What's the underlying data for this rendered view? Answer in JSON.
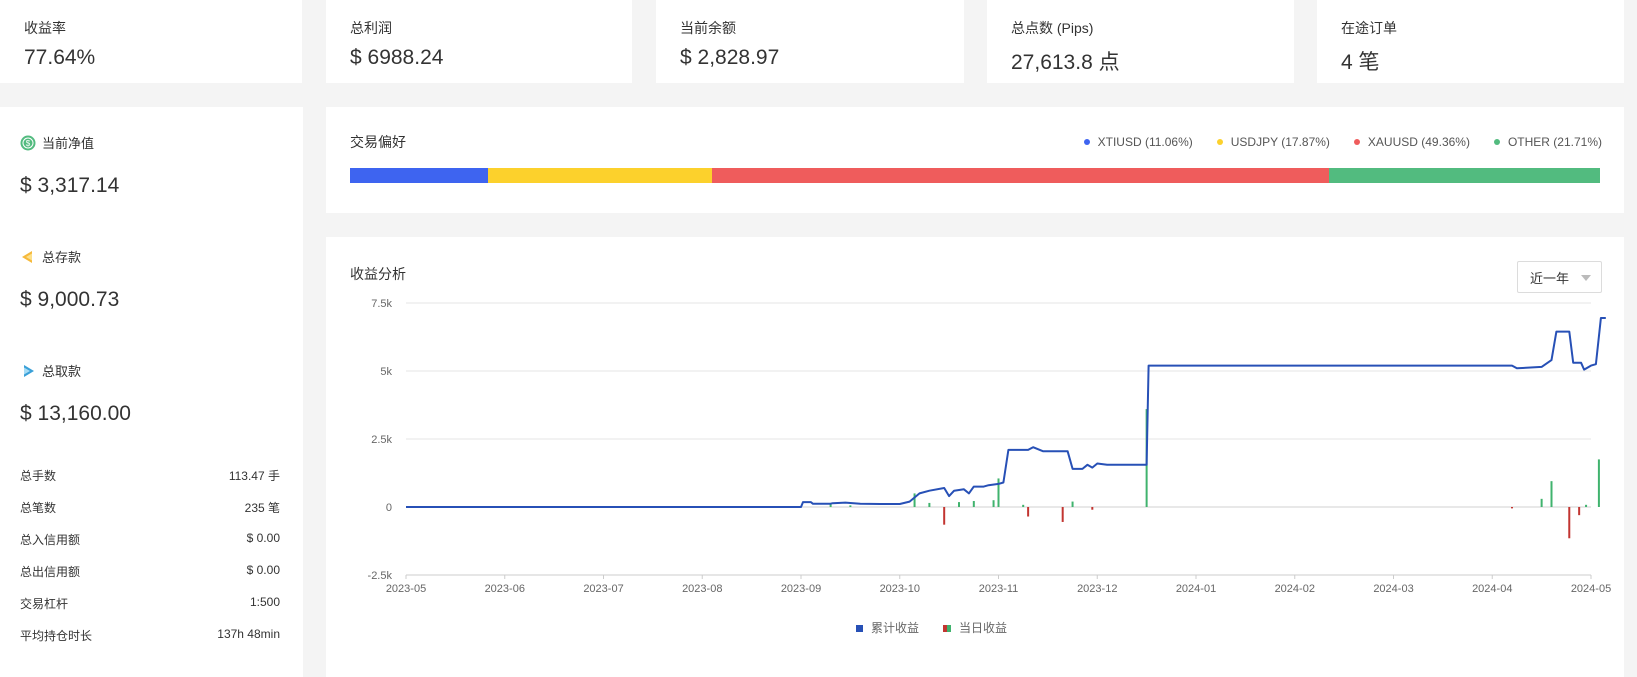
{
  "stats": [
    {
      "label": "收益率",
      "value": "77.64%"
    },
    {
      "label": "总利润",
      "value": "$ 6988.24"
    },
    {
      "label": "当前余额",
      "value": "$ 2,828.97"
    },
    {
      "label": "总点数 (Pips)",
      "value": "27,613.8 点"
    },
    {
      "label": "在途订单",
      "value": "4 笔"
    }
  ],
  "side": {
    "equity": {
      "label": "当前净值",
      "value": "$ 3,317.14",
      "icon": "dollar-circle-icon"
    },
    "deposit": {
      "label": "总存款",
      "value": "$ 9,000.73",
      "icon": "deposit-icon"
    },
    "withdraw": {
      "label": "总取款",
      "value": "$ 13,160.00",
      "icon": "withdraw-icon"
    },
    "details": [
      {
        "label": "总手数",
        "value": "113.47 手"
      },
      {
        "label": "总笔数",
        "value": "235 笔"
      },
      {
        "label": "总入信用额",
        "value": "$ 0.00"
      },
      {
        "label": "总出信用额",
        "value": "$ 0.00"
      },
      {
        "label": "交易杠杆",
        "value": "1:500"
      },
      {
        "label": "平均持仓时长",
        "value": "137h 48min"
      }
    ]
  },
  "preference": {
    "title": "交易偏好",
    "items": [
      {
        "label": "XTIUSD (11.06%)",
        "pct": 11.06,
        "color": "#3e64f0"
      },
      {
        "label": "USDJPY (17.87%)",
        "pct": 17.87,
        "color": "#fcd12c"
      },
      {
        "label": "XAUUSD (49.36%)",
        "pct": 49.36,
        "color": "#ef5c5c"
      },
      {
        "label": "OTHER (21.71%)",
        "pct": 21.71,
        "color": "#52bb7f"
      }
    ]
  },
  "analysis": {
    "title": "收益分析",
    "range_select": "近一年"
  },
  "chart_data": {
    "type": "line",
    "categories": [
      "2023-05",
      "2023-06",
      "2023-07",
      "2023-08",
      "2023-09",
      "2023-10",
      "2023-11",
      "2023-12",
      "2024-01",
      "2024-02",
      "2024-03",
      "2024-04",
      "2024-05"
    ],
    "ylim": [
      -2500,
      7500
    ],
    "yticks": [
      -2500,
      0,
      2500,
      5000,
      7500
    ],
    "ytick_labels": [
      "-2.5k",
      "0",
      "2.5k",
      "5k",
      "7.5k"
    ],
    "legend": {
      "cumulative": "累计收益",
      "daily": "当日收益"
    },
    "colors": {
      "cumulative": "#2750b6",
      "gain": "#40b36e",
      "loss": "#c23531"
    },
    "series": [
      {
        "name": "累计收益",
        "points": [
          [
            0,
            0
          ],
          [
            4.0,
            0
          ],
          [
            4.02,
            180
          ],
          [
            4.1,
            180
          ],
          [
            4.12,
            120
          ],
          [
            4.3,
            120
          ],
          [
            4.32,
            140
          ],
          [
            4.45,
            160
          ],
          [
            4.6,
            120
          ],
          [
            4.8,
            110
          ],
          [
            5.0,
            110
          ],
          [
            5.1,
            200
          ],
          [
            5.2,
            500
          ],
          [
            5.3,
            600
          ],
          [
            5.45,
            700
          ],
          [
            5.5,
            400
          ],
          [
            5.55,
            600
          ],
          [
            5.65,
            650
          ],
          [
            5.7,
            500
          ],
          [
            5.75,
            750
          ],
          [
            5.85,
            750
          ],
          [
            5.9,
            800
          ],
          [
            6.0,
            850
          ],
          [
            6.05,
            900
          ],
          [
            6.1,
            2100
          ],
          [
            6.2,
            2100
          ],
          [
            6.3,
            2100
          ],
          [
            6.35,
            2200
          ],
          [
            6.45,
            2050
          ],
          [
            6.7,
            2050
          ],
          [
            6.75,
            1400
          ],
          [
            6.85,
            1400
          ],
          [
            6.9,
            1550
          ],
          [
            6.95,
            1450
          ],
          [
            7.0,
            1600
          ],
          [
            7.1,
            1550
          ],
          [
            7.2,
            1550
          ],
          [
            7.5,
            1550
          ],
          [
            7.52,
            5200
          ],
          [
            7.7,
            5200
          ],
          [
            8.5,
            5200
          ],
          [
            9.5,
            5200
          ],
          [
            10.5,
            5200
          ],
          [
            11.2,
            5200
          ],
          [
            11.25,
            5100
          ],
          [
            11.5,
            5150
          ],
          [
            11.6,
            5400
          ],
          [
            11.65,
            6450
          ],
          [
            11.78,
            6450
          ],
          [
            11.82,
            5300
          ],
          [
            11.9,
            5300
          ],
          [
            11.93,
            5050
          ],
          [
            12.0,
            5200
          ],
          [
            12.05,
            5250
          ],
          [
            12.1,
            6950
          ],
          [
            12.15,
            6950
          ]
        ]
      },
      {
        "name": "当日收益",
        "bars": [
          [
            4.3,
            120
          ],
          [
            4.5,
            60
          ],
          [
            5.15,
            500
          ],
          [
            5.3,
            150
          ],
          [
            5.45,
            -650
          ],
          [
            5.6,
            180
          ],
          [
            5.75,
            220
          ],
          [
            5.95,
            250
          ],
          [
            6.0,
            1050
          ],
          [
            6.25,
            80
          ],
          [
            6.3,
            -350
          ],
          [
            6.65,
            -550
          ],
          [
            6.75,
            200
          ],
          [
            6.95,
            -100
          ],
          [
            7.5,
            3600
          ],
          [
            11.2,
            -50
          ],
          [
            11.5,
            300
          ],
          [
            11.6,
            950
          ],
          [
            11.78,
            -1150
          ],
          [
            11.88,
            -300
          ],
          [
            11.95,
            80
          ],
          [
            12.08,
            1750
          ]
        ]
      }
    ]
  }
}
